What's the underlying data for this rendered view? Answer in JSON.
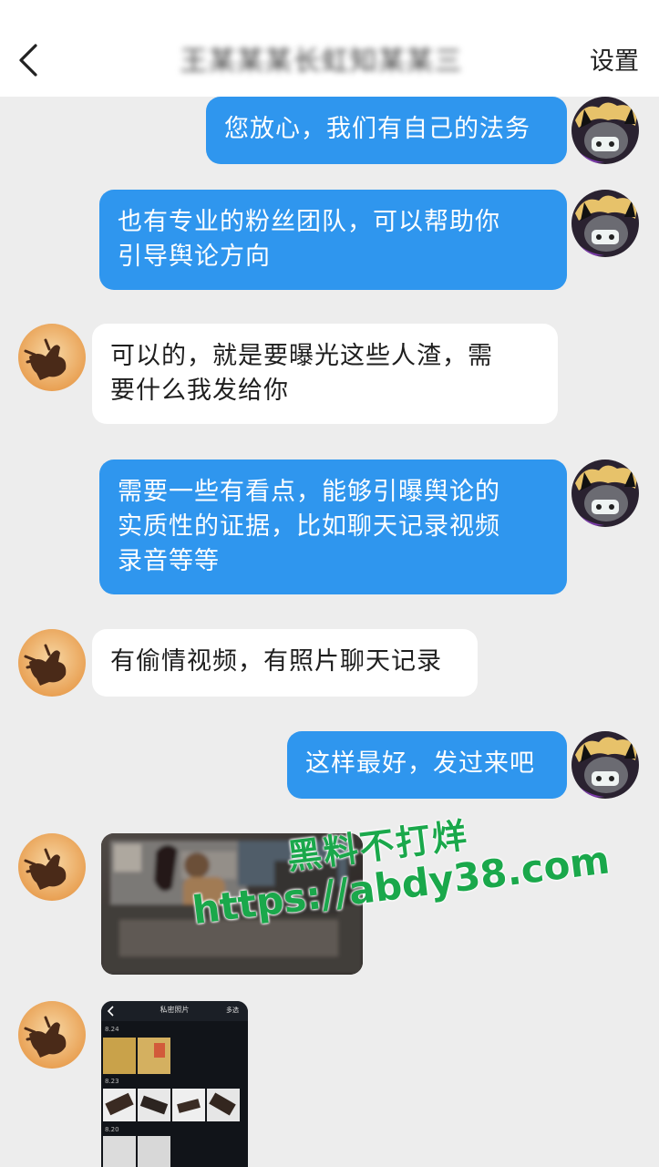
{
  "header": {
    "back_icon": "chevron-left-icon",
    "title": "王某某某长虹知某某三",
    "settings_label": "设置"
  },
  "messages": [
    {
      "side": "me",
      "text": "您放心，我们有自己的法务"
    },
    {
      "side": "me",
      "text": "也有专业的粉丝团队，可以帮助你\n引导舆论方向"
    },
    {
      "side": "other",
      "text": "可以的，就是要曝光这些人渣，需\n要什么我发给你"
    },
    {
      "side": "me",
      "text": "需要一些有看点，能够引曝舆论的\n实质性的证据，比如聊天记录视频\n录音等等"
    },
    {
      "side": "other",
      "text": "有偷情视频，有照片聊天记录"
    },
    {
      "side": "me",
      "text": "这样最好，发过来吧"
    },
    {
      "side": "other",
      "type": "video"
    },
    {
      "side": "other",
      "type": "image",
      "screenshot_title": "私密照片",
      "screenshot_action": "多选",
      "dates": [
        "8.24",
        "8.23",
        "8.20"
      ]
    }
  ],
  "watermark": {
    "line1": "黑料不打烊",
    "line2": "https://abdy38.com"
  },
  "colors": {
    "my_bubble": "#2f96ee",
    "other_bubble": "#ffffff",
    "background": "#ededed",
    "watermark": "#1aa84b"
  }
}
